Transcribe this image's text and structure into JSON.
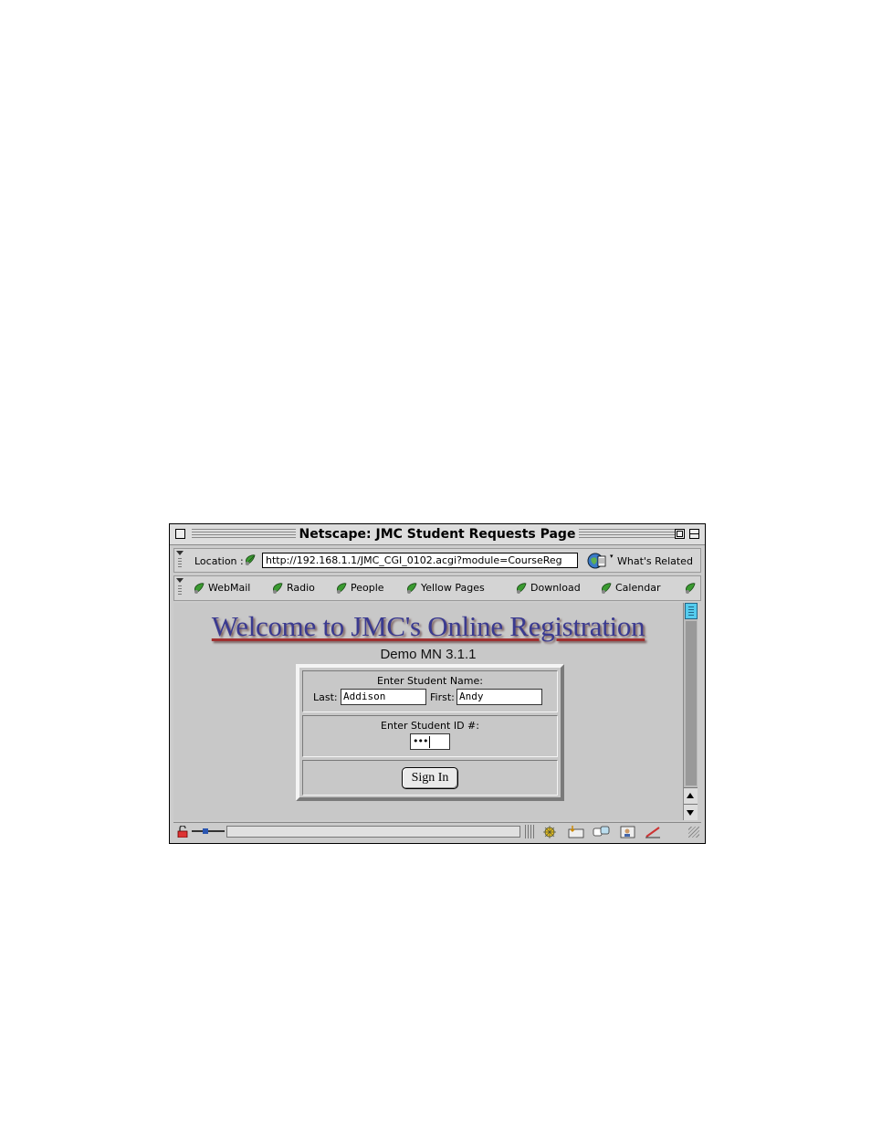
{
  "window": {
    "title": "Netscape: JMC Student Requests Page"
  },
  "location_bar": {
    "label": "Location :",
    "url": "http://192.168.1.1/JMC_CGI_0102.acgi?module=CourseReg",
    "related_label": "What's Related"
  },
  "personal_toolbar": {
    "items": [
      {
        "label": "WebMail"
      },
      {
        "label": "Radio"
      },
      {
        "label": "People"
      },
      {
        "label": "Yellow Pages"
      },
      {
        "label": "Download"
      },
      {
        "label": "Calendar"
      }
    ]
  },
  "page": {
    "heading": "Welcome to JMC's Online Registration",
    "subheading": "Demo MN 3.1.1",
    "form": {
      "name_prompt": "Enter Student Name:",
      "last_label": "Last:",
      "last_value": "Addison",
      "first_label": "First:",
      "first_value": "Andy",
      "id_prompt": "Enter Student ID #:",
      "id_masked": "•••",
      "sign_in_label": "Sign In"
    }
  },
  "colors": {
    "heading": "#3a3a90",
    "heading_shadow": "#7a6060",
    "scroll_thumb": "#55ccee",
    "netscape_leaf": "#3a9a30"
  },
  "icons": {
    "bookmark": "netscape-leaf-icon",
    "related": "whats-related-icon",
    "security": "padlock-icon",
    "connection": "plug-icon"
  }
}
